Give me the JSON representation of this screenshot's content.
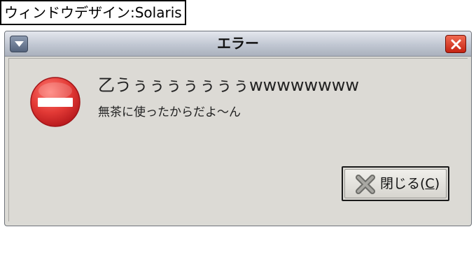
{
  "caption": "ウィンドウデザイン:Solaris",
  "window": {
    "title": "エラー"
  },
  "dialog": {
    "icon": "error-stop-icon",
    "primary_text": "乙うぅぅぅぅぅぅぅwwwwwwww",
    "secondary_text": "無茶に使ったからだよ～ん"
  },
  "close_button": {
    "icon": "close-x-icon",
    "label": "閉じる(",
    "mnemonic": "C",
    "label_end": ")"
  },
  "colors": {
    "titlebar_top": "#e4e7ee",
    "titlebar_bottom": "#aab1bd",
    "window_bg": "#dbdad5",
    "error_red": "#e33a36",
    "close_red": "#d8341f"
  }
}
